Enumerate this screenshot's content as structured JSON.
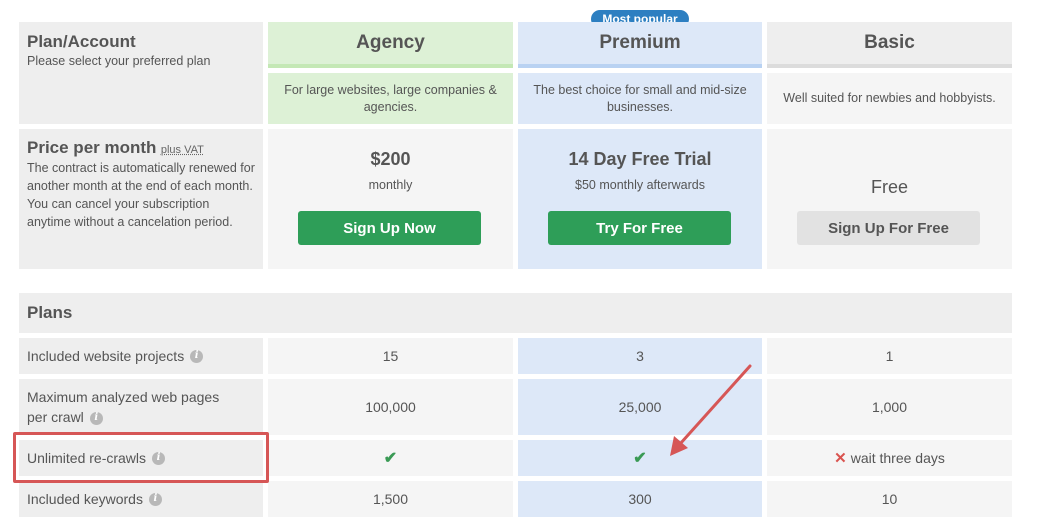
{
  "header": {
    "left_title": "Plan/Account",
    "left_subtitle": "Please select your preferred plan",
    "badge": "Most popular",
    "plans": [
      {
        "name": "Agency",
        "desc": "For large websites, large companies & agencies."
      },
      {
        "name": "Premium",
        "desc": "The best choice for small and mid-size businesses."
      },
      {
        "name": "Basic",
        "desc": "Well suited for newbies and hobbyists."
      }
    ]
  },
  "price": {
    "left_title": "Price per month",
    "left_title_suffix": "plus VAT",
    "left_desc": "The contract is automatically renewed for another month at the end of each month. You can cancel your subscription anytime without a cancelation period.",
    "agency": {
      "amount": "$200",
      "period": "monthly",
      "button": "Sign Up Now"
    },
    "premium": {
      "amount": "14 Day Free Trial",
      "period": "$50 monthly afterwards",
      "button": "Try For Free"
    },
    "basic": {
      "amount": "Free",
      "button": "Sign Up For Free"
    }
  },
  "plans_section": {
    "title": "Plans",
    "rows": [
      {
        "label": "Included website projects",
        "agency": "15",
        "premium": "3",
        "basic": "1"
      },
      {
        "label": "Maximum analyzed web pages per crawl",
        "agency": "100,000",
        "premium": "25,000",
        "basic": "1,000"
      },
      {
        "label": "Unlimited re-crawls",
        "agency": "✔",
        "premium": "✔",
        "basic": "wait three days"
      },
      {
        "label": "Included keywords",
        "agency": "1,500",
        "premium": "300",
        "basic": "10"
      }
    ],
    "info_glyph": "i",
    "cross_glyph": "✕"
  },
  "colors": {
    "agency_accent": "#c4e8b5",
    "premium_accent": "#b9d2f2",
    "basic_accent": "#dcdcdc",
    "button_green": "#2e9e58",
    "badge_blue": "#2d7fc1",
    "annotation_red": "#d65656"
  },
  "icons": [
    "info-icon",
    "check-icon",
    "cross-icon",
    "arrow-annotation"
  ]
}
